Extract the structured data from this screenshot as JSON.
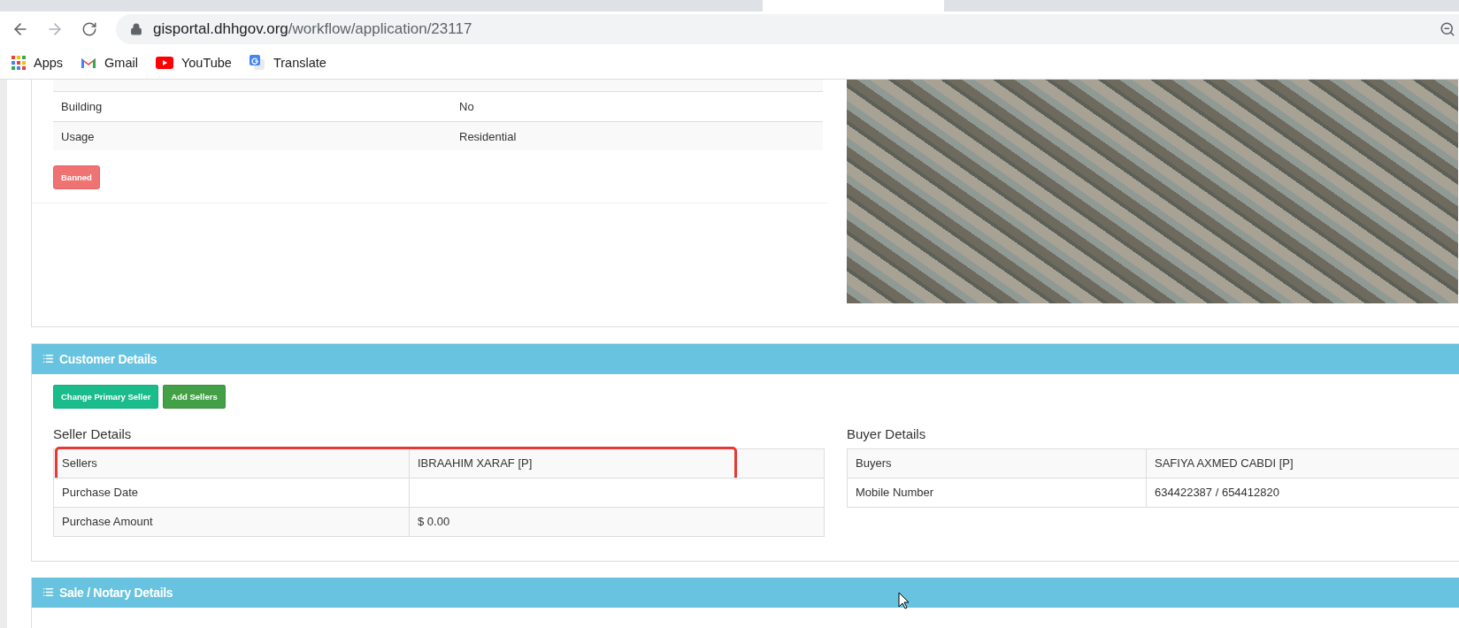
{
  "browser": {
    "url": {
      "domain": "gisportal.dhhgov.org",
      "path": "/workflow/application/23117"
    },
    "bookmarks": [
      {
        "label": "Apps",
        "kind": "apps"
      },
      {
        "label": "Gmail",
        "kind": "gmail"
      },
      {
        "label": "YouTube",
        "kind": "youtube"
      },
      {
        "label": "Translate",
        "kind": "translate"
      }
    ]
  },
  "parcel": {
    "rows": [
      {
        "label": "Building",
        "value": "No"
      },
      {
        "label": "Usage",
        "value": "Residential"
      }
    ],
    "banned_button": "Banned"
  },
  "customer_details": {
    "title": "Customer Details",
    "buttons": [
      {
        "label": "Change Primary Seller",
        "kind": "primary"
      },
      {
        "label": "Add Sellers",
        "kind": "success"
      }
    ],
    "seller": {
      "title": "Seller Details",
      "rows": [
        {
          "label": "Sellers",
          "value": "IBRAAHIM XARAF [P]",
          "highlighted": true
        },
        {
          "label": "Purchase Date",
          "value": "",
          "highlighted": false
        },
        {
          "label": "Purchase Amount",
          "value": "$ 0.00",
          "highlighted": false
        }
      ]
    },
    "buyer": {
      "title": "Buyer Details",
      "rows": [
        {
          "label": "Buyers",
          "value": "SAFIYA AXMED CABDI [P]",
          "highlighted": false
        },
        {
          "label": "Mobile Number",
          "value": "634422387 / 654412820",
          "highlighted": false
        }
      ]
    }
  },
  "sale_notary": {
    "title": "Sale / Notary Details"
  }
}
